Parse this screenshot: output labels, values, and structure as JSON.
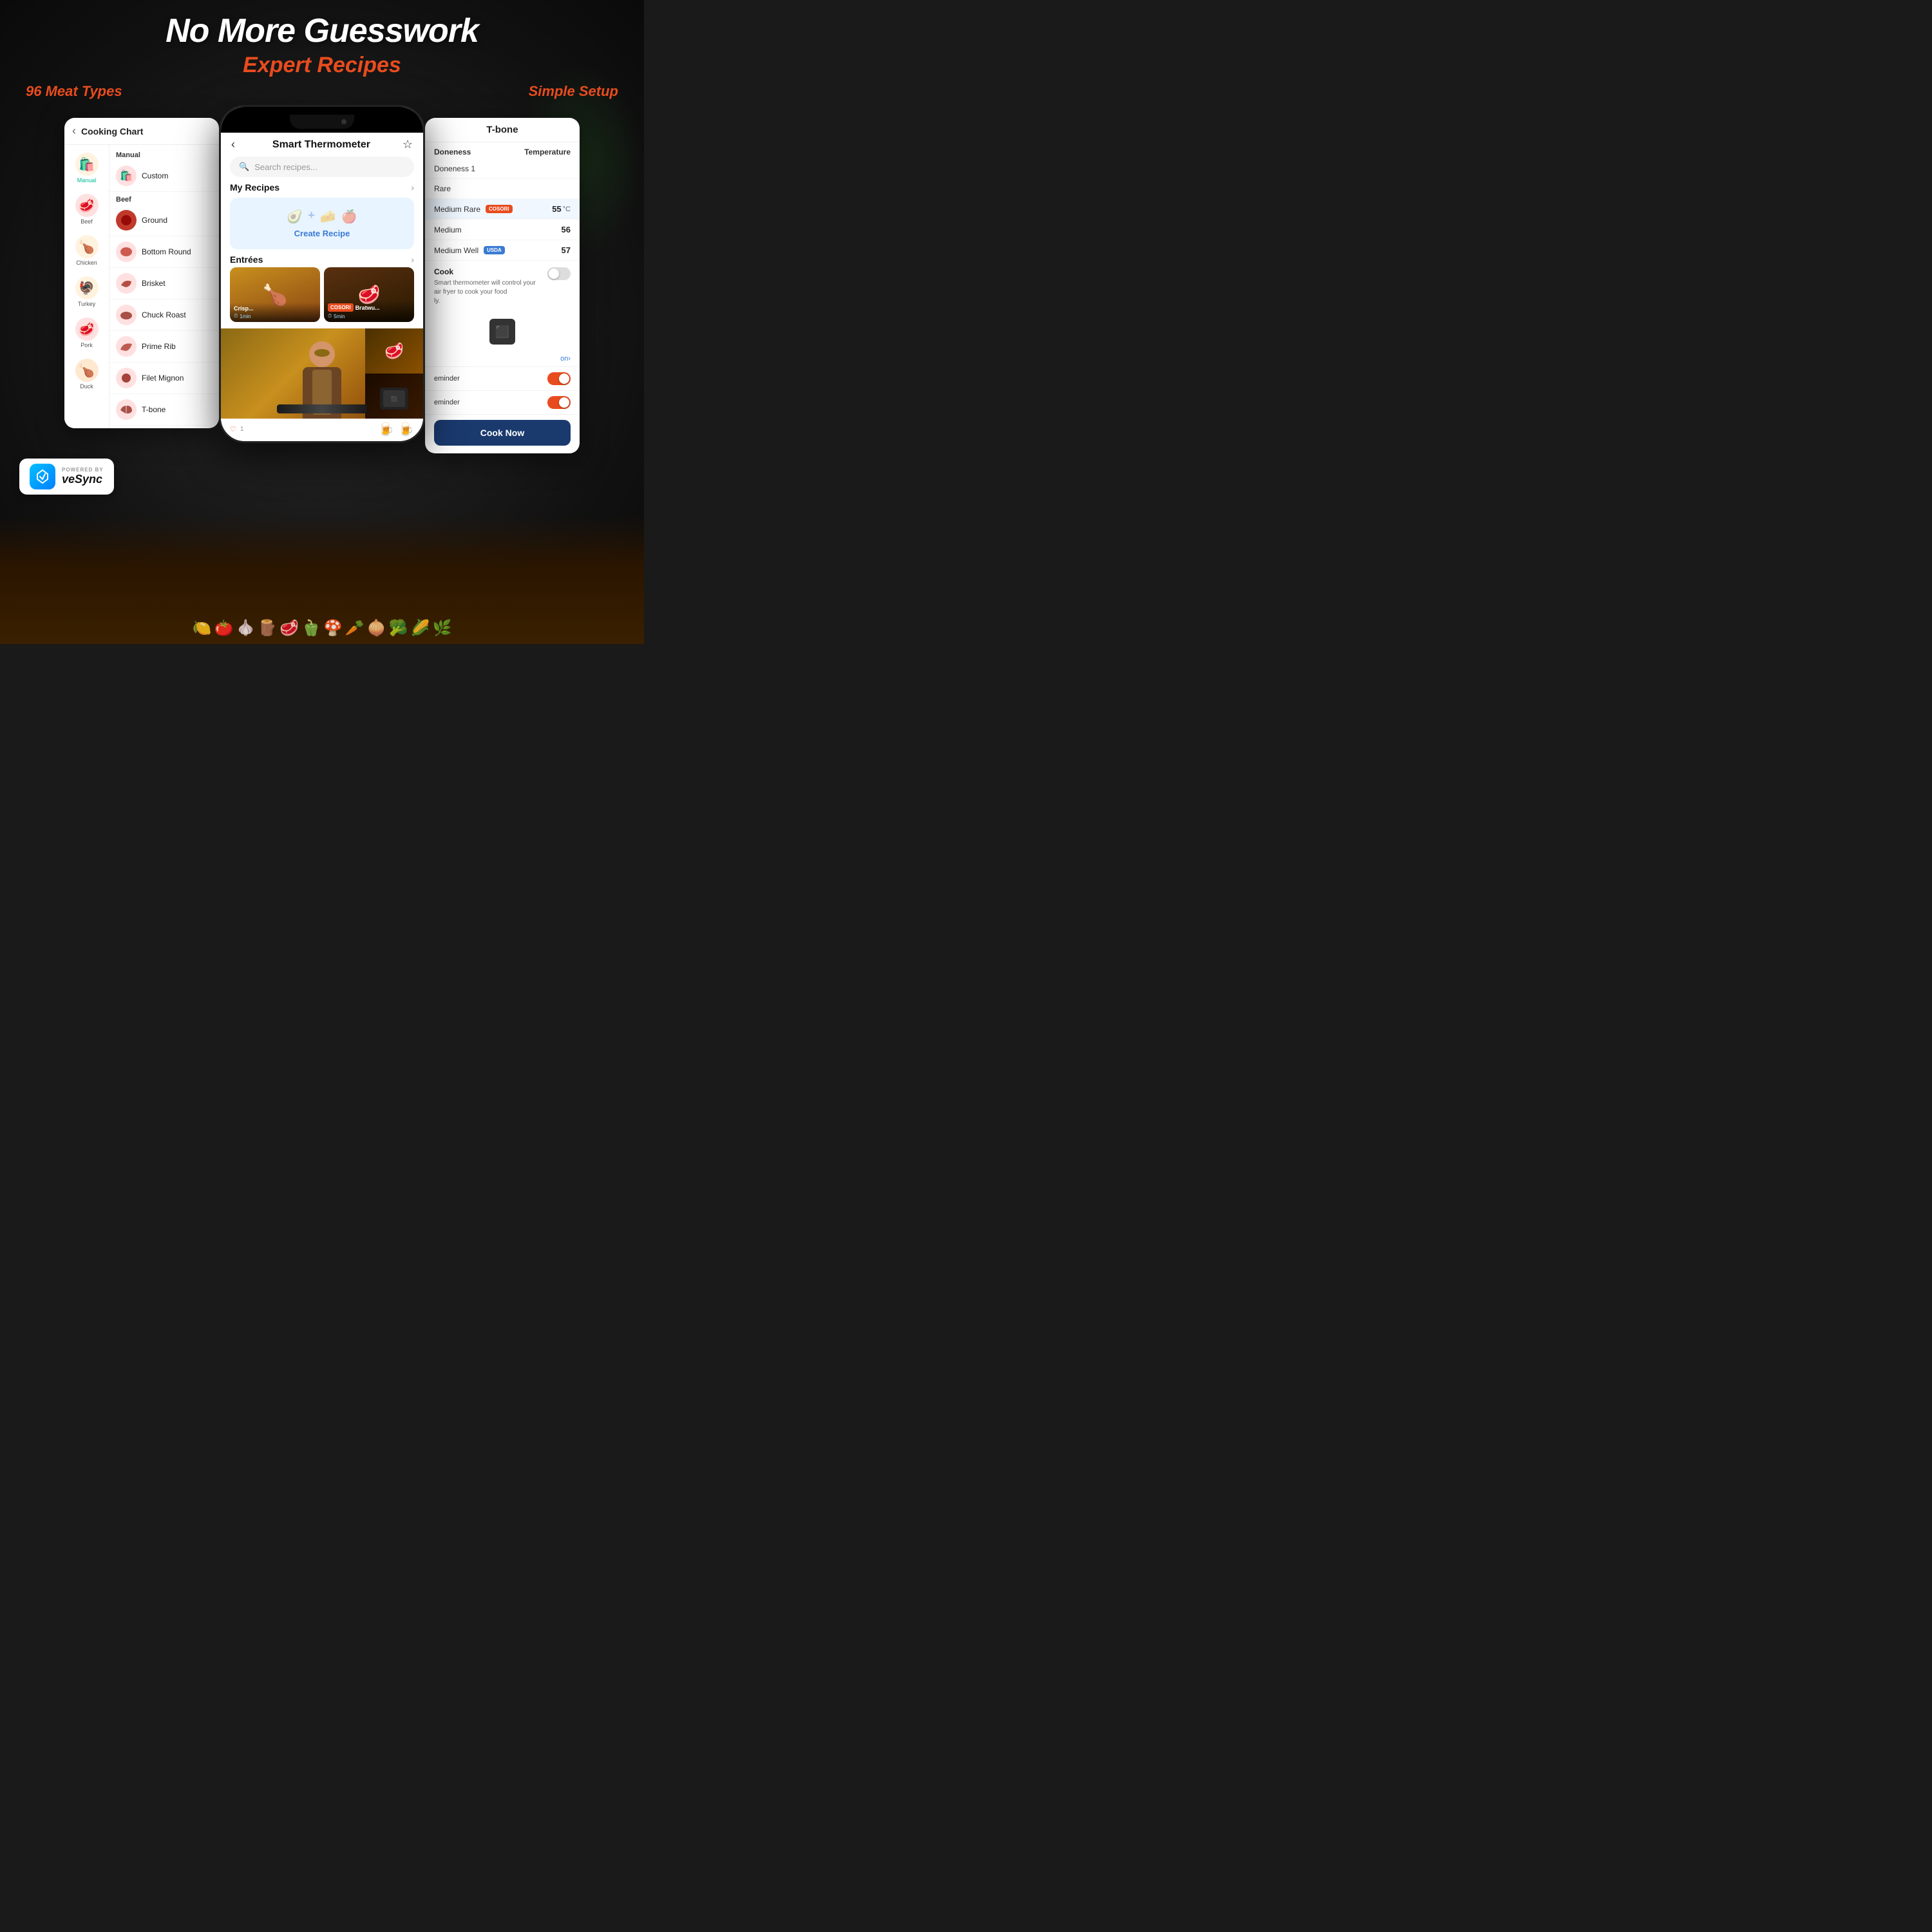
{
  "header": {
    "main_title": "No More Guesswork",
    "sub_title": "Expert Recipes"
  },
  "section_labels": {
    "left": "96 Meat Types",
    "center": "",
    "right": "Simple Setup"
  },
  "left_panel": {
    "title": "Cooking Chart",
    "back_label": "‹",
    "categories": [
      {
        "name": "Manual",
        "emoji": "🛍️",
        "active": true
      },
      {
        "name": "Beef",
        "emoji": "🥩",
        "active": false
      },
      {
        "name": "Chicken",
        "emoji": "🍗",
        "active": false
      },
      {
        "name": "Turkey",
        "emoji": "🍗",
        "active": false
      },
      {
        "name": "Pork",
        "emoji": "🥩",
        "active": false
      },
      {
        "name": "Duck",
        "emoji": "🍗",
        "active": false
      }
    ],
    "meat_sections": [
      {
        "label": "Manual",
        "items": [
          {
            "name": "Custom",
            "emoji": "🛍️"
          }
        ]
      },
      {
        "label": "Beef",
        "items": [
          {
            "name": "Ground",
            "emoji": "🥩"
          },
          {
            "name": "Bottom Round",
            "emoji": "🥩"
          },
          {
            "name": "Brisket",
            "emoji": "🥩"
          },
          {
            "name": "Chuck Roast",
            "emoji": "🥩"
          },
          {
            "name": "Prime Rib",
            "emoji": "🥩"
          },
          {
            "name": "Filet Mignon",
            "emoji": "🥩"
          },
          {
            "name": "T-bone",
            "emoji": "🥩"
          }
        ]
      }
    ]
  },
  "center_panel": {
    "title": "Smart Thermometer",
    "back_label": "‹",
    "fav_label": "☆",
    "search_placeholder": "Search recipes...",
    "my_recipes_label": "My Recipes",
    "create_recipe_label": "Create Recipe",
    "entrees_label": "Entrées",
    "recipe_cards": [
      {
        "name": "Crispy...",
        "time": "1min"
      },
      {
        "name": "Bratwu...",
        "cosori": true,
        "time": "5min"
      }
    ]
  },
  "right_panel": {
    "title": "T-bone",
    "doneness_col": "Doneness",
    "temperature_col": "Temperature",
    "doneness_options": [
      {
        "name": "Doneness 1",
        "badge": null,
        "temp": null,
        "unit": null
      },
      {
        "name": "Rare",
        "badge": null,
        "temp": null,
        "unit": null
      },
      {
        "name": "Medium Rare",
        "badge": "COSORI",
        "badge_type": "cosori",
        "temp": "55",
        "unit": "°C",
        "highlighted": true
      },
      {
        "name": "Medium",
        "badge": null,
        "temp": "56",
        "unit": null
      },
      {
        "name": "Medium Well",
        "badge": "USDA",
        "badge_type": "usda",
        "temp": "57",
        "unit": null
      }
    ],
    "smart_cook_label": "Cook",
    "smart_cook_desc": "Smart thermometer will control your\nair fryer to cook your food\nly.",
    "on_label": "on",
    "reminder_label": "eminder",
    "reminder2_label": "eminder",
    "cook_now_label": "Cook Now"
  },
  "powered_by": {
    "label": "POWERED BY",
    "brand": "veSync"
  }
}
